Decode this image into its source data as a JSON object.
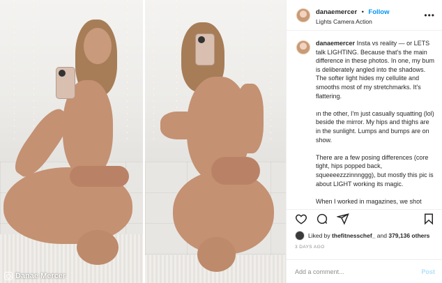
{
  "post": {
    "username": "danaemercer",
    "follow_label": "Follow",
    "separator": "•",
    "location": "Lights Camera Action",
    "more_label": "•••"
  },
  "caption": {
    "username": "danaemercer",
    "paragraphs": [
      "Insta vs reality — or LETS talk LIGHTING. Because that's the main difference in these photos. In one, my bum is deliberately angled into the shadows. The softer light hides my cellulite and smooths most of my stretchmarks. It's flattering.",
      "ın the other, I'm just casually squatting (lol) beside the mirror. My hips and thighs are in the sunlight. Lumps and bumps are on show.",
      "There are a few posing differences (core tight, hips popped back, squeeeezzzinnnggg), but mostly this pic is about LIGHT working its magic.",
      "When I worked in magazines, we shot"
    ]
  },
  "likes": {
    "prefix": "Liked by",
    "user": "thefitnesschef_",
    "middle": "and",
    "count": "379,136 others"
  },
  "timestamp": "3 DAYS AGO",
  "comment": {
    "placeholder": "Add a comment...",
    "post_label": "Post"
  },
  "watermark": "Danae Mercer",
  "icons": {
    "like": "heart-icon",
    "comment": "comment-icon",
    "share": "share-icon",
    "save": "bookmark-icon",
    "more": "more-options-icon"
  },
  "colors": {
    "link_blue": "#0095f6",
    "post_disabled": "#b2dffc",
    "muted_text": "#8e8e8e",
    "border": "#efefef"
  }
}
